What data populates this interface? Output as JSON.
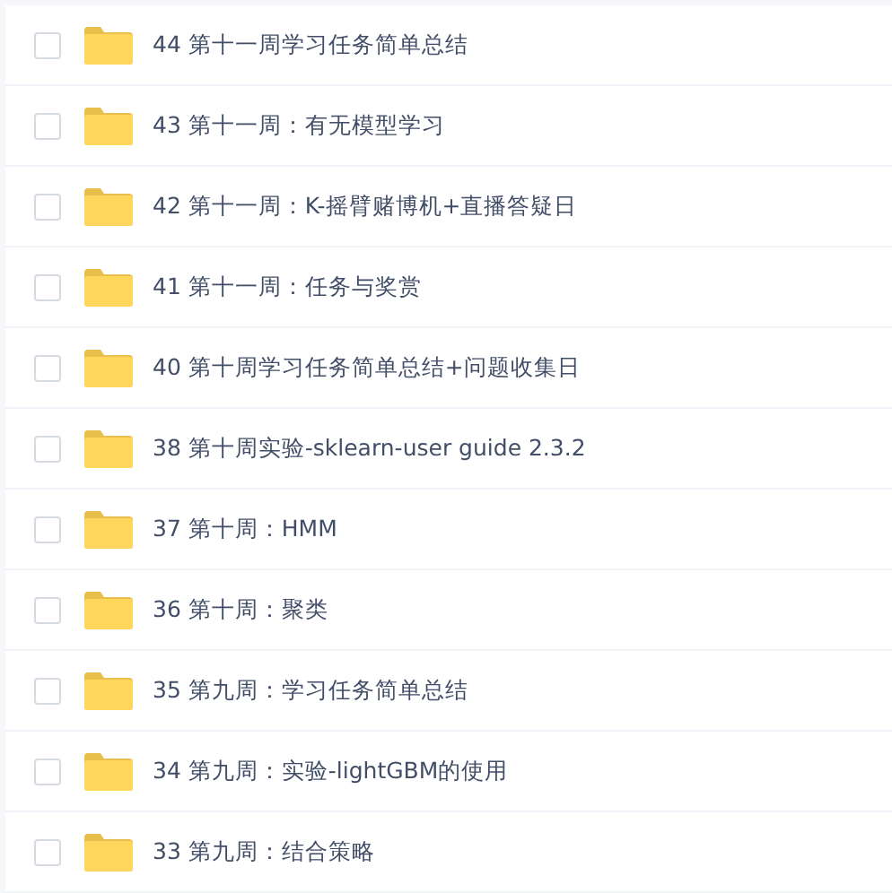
{
  "files": [
    {
      "name": "44 第十一周学习任务简单总结",
      "checked": false
    },
    {
      "name": "43 第十一周：有无模型学习",
      "checked": false
    },
    {
      "name": "42 第十一周：K-摇臂赌博机+直播答疑日",
      "checked": false
    },
    {
      "name": "41 第十一周：任务与奖赏",
      "checked": false
    },
    {
      "name": "40 第十周学习任务简单总结+问题收集日",
      "checked": false
    },
    {
      "name": "38 第十周实验-sklearn-user guide 2.3.2",
      "checked": false
    },
    {
      "name": "37 第十周：HMM",
      "checked": false
    },
    {
      "name": "36 第十周：聚类",
      "checked": false
    },
    {
      "name": "35 第九周：学习任务简单总结",
      "checked": false
    },
    {
      "name": "34 第九周：实验-lightGBM的使用",
      "checked": false
    },
    {
      "name": "33 第九周：结合策略",
      "checked": false
    }
  ]
}
